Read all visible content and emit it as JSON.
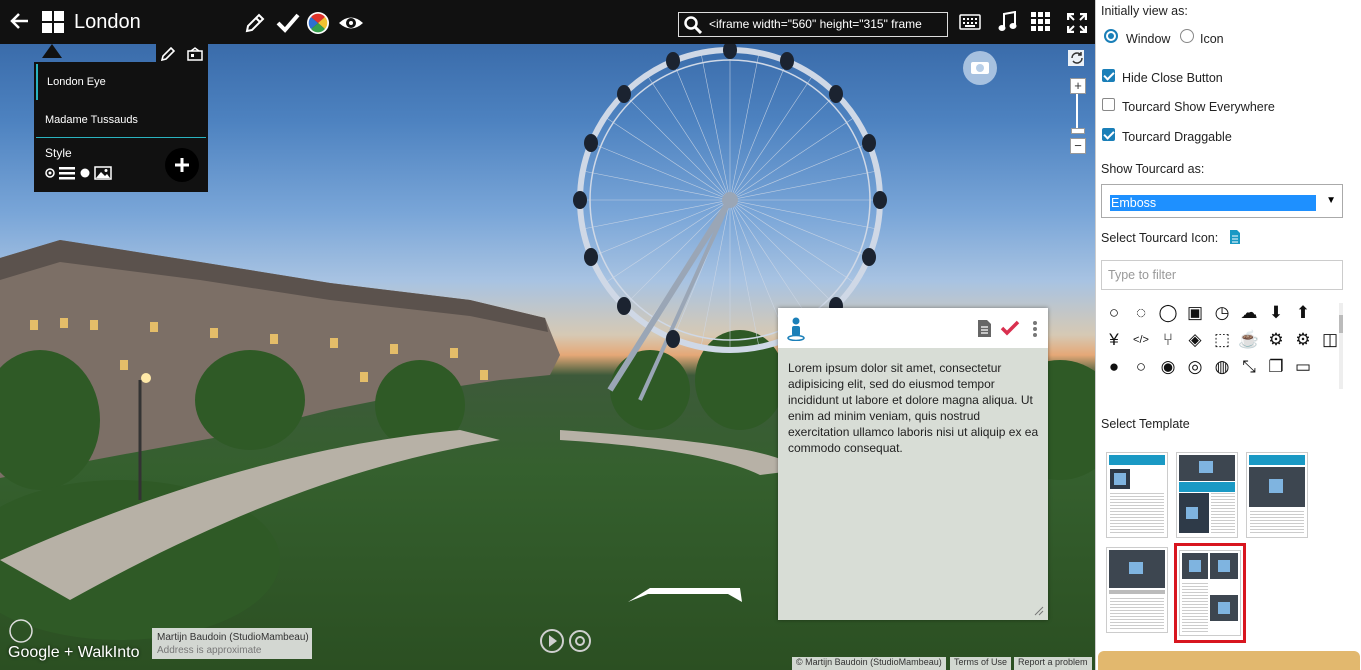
{
  "window": {
    "title": "London",
    "search": {
      "value": "<iframe width=\"560\" height=\"315\" frame"
    }
  },
  "toolbar": {
    "left_icons": [
      "back-arrow-icon",
      "grid-icon"
    ],
    "mode_icons": [
      "pencil-icon",
      "check-icon",
      "color-wheel-icon",
      "eye-icon"
    ],
    "right_icons": [
      "search-icon",
      "keyboard-icon",
      "music-icon",
      "apps-grid-icon",
      "fullscreen-icon"
    ]
  },
  "poi_menu": {
    "items": [
      "London Eye",
      "Madame Tussauds"
    ],
    "style_label": "Style",
    "tool_icons": [
      "pencil-icon",
      "scene-icon"
    ],
    "style_icons": [
      "dot-small-icon",
      "list-icon",
      "dot-icon",
      "image-icon"
    ],
    "add_icon": "plus-icon"
  },
  "tourcard": {
    "text": "Lorem ipsum dolor sit amet, consectetur adipisicing elit, sed do eiusmod tempor incididunt ut labore et dolore magna aliqua. Ut enim ad minim veniam, quis nostrud exercitation ullamco laboris nisi ut aliquip ex ea commodo consequat.",
    "icons": [
      "person-icon",
      "document-icon",
      "check-icon",
      "more-vertical-icon"
    ]
  },
  "map_overlay": {
    "author": "Martijn Baudoin (StudioMambeau)",
    "address_note": "Address is approximate",
    "brand": "Google + WalkInto",
    "footer_links": [
      "© Martijn Baudoin (StudioMambeau)",
      "Terms of Use",
      "Report a problem"
    ]
  },
  "panel": {
    "initially_view_label": "Initially view as:",
    "view_options": [
      {
        "label": "Window",
        "selected": true
      },
      {
        "label": "Icon",
        "selected": false
      }
    ],
    "checkboxes": [
      {
        "label": "Hide Close Button",
        "checked": true
      },
      {
        "label": "Tourcard Show Everywhere",
        "checked": false
      },
      {
        "label": "Tourcard Draggable",
        "checked": true
      }
    ],
    "show_as_label": "Show Tourcard as:",
    "show_as_value": "Emboss",
    "select_icon_label": "Select Tourcard Icon:",
    "filter_placeholder": "Type to filter",
    "icon_grid": [
      "circle-icon",
      "circle-notch-icon",
      "circle-thin-icon",
      "clipboard-icon",
      "clock-icon",
      "cloud-icon",
      "cloud-download-icon",
      "cloud-upload-icon",
      "yen-icon",
      "code-icon",
      "code-fork-icon",
      "codepen-icon",
      "cube-icon",
      "coffee-icon",
      "cog-icon",
      "cogs-icon",
      "columns-icon",
      "comment-icon",
      "comment-o-icon",
      "comments-icon",
      "commenting-icon",
      "compass-icon",
      "compress-icon",
      "copy-icon",
      "credit-card-icon"
    ],
    "select_template_label": "Select Template",
    "templates": [
      "template-1",
      "template-2",
      "template-3",
      "template-4",
      "template-5"
    ],
    "selected_template": "template-5"
  },
  "colors": {
    "accent": "#1a7fb8",
    "selected_border": "#d8161f",
    "check_red": "#d9304f",
    "template_header": "#1a99c4",
    "bottom_bar": "#e2b86e"
  }
}
